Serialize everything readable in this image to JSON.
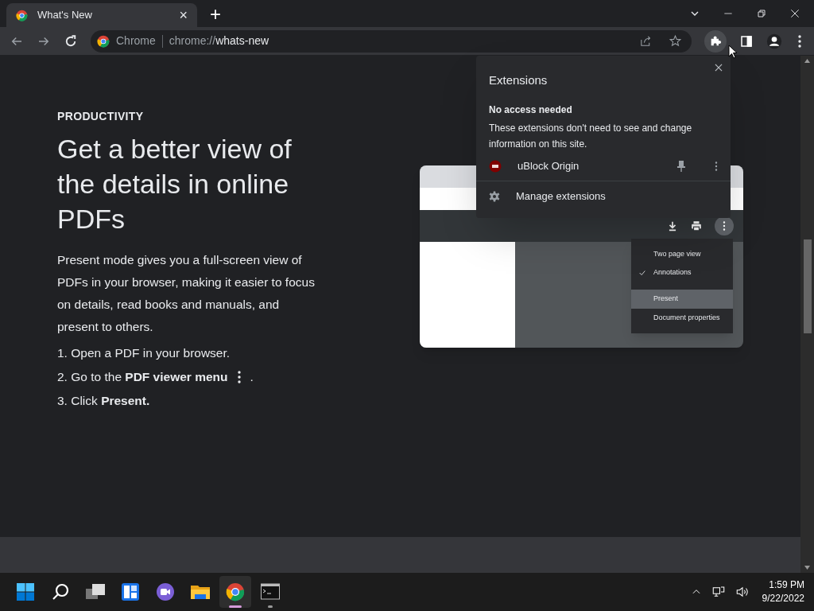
{
  "tabs": [
    {
      "title": "What's New",
      "selected": true,
      "close": "×"
    }
  ],
  "new_tab": "+",
  "address_bar": {
    "site": "Chrome",
    "url_prefix": "chrome://",
    "url_path": "whats-new"
  },
  "article": {
    "category": "PRODUCTIVITY",
    "headline": "Get a better view of the details in online PDFs",
    "body": "Present mode gives you a full-screen view of PDFs in your browser, making it easier to focus on details, read books and manuals, and present to others.",
    "steps": [
      {
        "text": "1. Open a PDF in your browser."
      },
      {
        "text": "2. Go to the **PDF viewer menu**",
        "icon": true,
        "suffix": "."
      },
      {
        "text": "3. Click **Present.**"
      }
    ]
  },
  "illustration": {
    "menu": [
      {
        "label": "Two page view",
        "checked": false,
        "selected": false
      },
      {
        "label": "Annotations",
        "checked": true,
        "selected": false
      },
      {
        "label": "Present",
        "checked": false,
        "selected": true
      },
      {
        "label": "Document properties",
        "checked": false,
        "selected": false
      }
    ]
  },
  "extensions_popup": {
    "title": "Extensions",
    "section_title": "No access needed",
    "section_text": "These extensions don't need to see and change information on this site.",
    "extensions": [
      {
        "name": "uBlock Origin",
        "pinned": false
      }
    ],
    "manage": "Manage extensions"
  },
  "taskbar": {
    "apps": [
      {
        "kind": "start"
      },
      {
        "kind": "search"
      },
      {
        "kind": "taskview"
      },
      {
        "kind": "widgets"
      },
      {
        "kind": "chat"
      },
      {
        "kind": "explorer"
      },
      {
        "kind": "chrome",
        "active": true
      },
      {
        "kind": "terminal",
        "active": false
      }
    ],
    "time": "1:59 PM",
    "date": "9/22/2022"
  }
}
